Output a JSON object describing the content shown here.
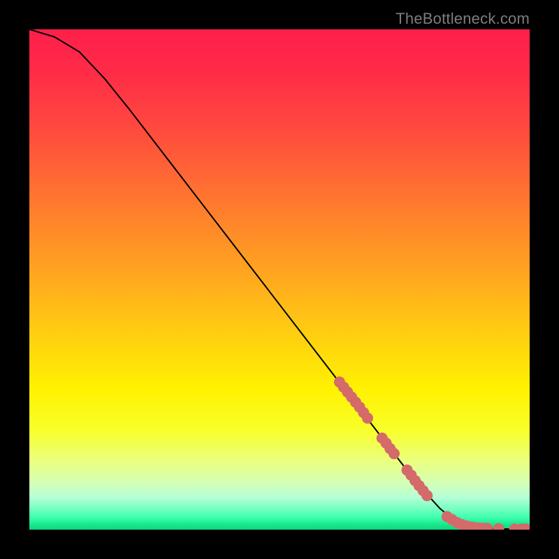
{
  "attribution": "TheBottleneck.com",
  "chart_data": {
    "type": "line",
    "title": "",
    "xlabel": "",
    "ylabel": "",
    "xlim": [
      0,
      100
    ],
    "ylim": [
      0,
      100
    ],
    "background_gradient_stops": [
      {
        "offset": 0.0,
        "color": "#ff1f4a"
      },
      {
        "offset": 0.08,
        "color": "#ff2a48"
      },
      {
        "offset": 0.2,
        "color": "#ff4a3e"
      },
      {
        "offset": 0.35,
        "color": "#ff7a2e"
      },
      {
        "offset": 0.5,
        "color": "#ffa91e"
      },
      {
        "offset": 0.62,
        "color": "#ffd20f"
      },
      {
        "offset": 0.72,
        "color": "#fff200"
      },
      {
        "offset": 0.8,
        "color": "#f9ff2a"
      },
      {
        "offset": 0.86,
        "color": "#eaff7a"
      },
      {
        "offset": 0.905,
        "color": "#d6ffb4"
      },
      {
        "offset": 0.935,
        "color": "#b6ffd6"
      },
      {
        "offset": 0.955,
        "color": "#7fffc4"
      },
      {
        "offset": 0.975,
        "color": "#3fffad"
      },
      {
        "offset": 0.99,
        "color": "#18e88c"
      },
      {
        "offset": 1.0,
        "color": "#0fd47f"
      }
    ],
    "curve": {
      "x": [
        0,
        5,
        10,
        15,
        20,
        25,
        30,
        35,
        40,
        45,
        50,
        55,
        60,
        65,
        70,
        75,
        80,
        82,
        84,
        86,
        88,
        90,
        92,
        94,
        96,
        98,
        100
      ],
      "y": [
        100,
        98.5,
        95.5,
        90.2,
        84.0,
        77.5,
        71.0,
        64.5,
        58.0,
        51.5,
        45.0,
        38.5,
        32.0,
        25.5,
        19.0,
        12.5,
        6.5,
        4.3,
        2.6,
        1.4,
        0.7,
        0.35,
        0.2,
        0.15,
        0.13,
        0.12,
        0.12
      ]
    },
    "scatter": {
      "color": "#d46a6a",
      "radius_px": 8,
      "points": [
        {
          "x": 62.0,
          "y": 29.5
        },
        {
          "x": 62.8,
          "y": 28.5
        },
        {
          "x": 63.6,
          "y": 27.5
        },
        {
          "x": 64.4,
          "y": 26.5
        },
        {
          "x": 65.2,
          "y": 25.5
        },
        {
          "x": 66.0,
          "y": 24.5
        },
        {
          "x": 66.8,
          "y": 23.4
        },
        {
          "x": 67.6,
          "y": 22.3
        },
        {
          "x": 70.5,
          "y": 18.3
        },
        {
          "x": 71.3,
          "y": 17.3
        },
        {
          "x": 72.1,
          "y": 16.2
        },
        {
          "x": 72.9,
          "y": 15.2
        },
        {
          "x": 75.5,
          "y": 11.9
        },
        {
          "x": 76.3,
          "y": 10.9
        },
        {
          "x": 77.1,
          "y": 9.8
        },
        {
          "x": 77.9,
          "y": 8.8
        },
        {
          "x": 78.7,
          "y": 7.8
        },
        {
          "x": 79.5,
          "y": 6.8
        },
        {
          "x": 83.5,
          "y": 2.6
        },
        {
          "x": 84.5,
          "y": 2.0
        },
        {
          "x": 85.5,
          "y": 1.4
        },
        {
          "x": 86.5,
          "y": 1.0
        },
        {
          "x": 87.5,
          "y": 0.7
        },
        {
          "x": 88.5,
          "y": 0.5
        },
        {
          "x": 89.5,
          "y": 0.35
        },
        {
          "x": 90.5,
          "y": 0.3
        },
        {
          "x": 91.5,
          "y": 0.25
        },
        {
          "x": 93.8,
          "y": 0.18
        },
        {
          "x": 97.0,
          "y": 0.12
        },
        {
          "x": 98.4,
          "y": 0.12
        },
        {
          "x": 99.2,
          "y": 0.12
        }
      ]
    }
  }
}
